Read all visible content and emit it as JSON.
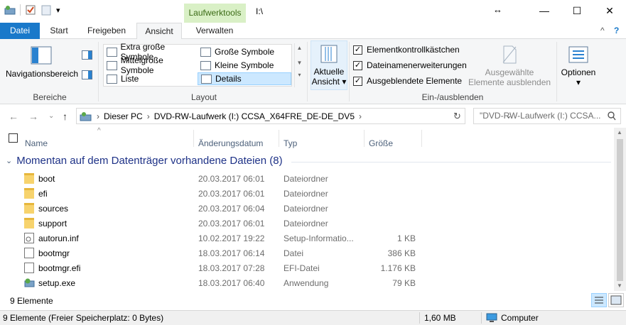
{
  "window": {
    "title": "I:\\",
    "context_tab_group": "Laufwerktools",
    "controls": {
      "minimize": "—",
      "maximize": "☐",
      "close": "✕",
      "resize": "↔"
    }
  },
  "qat": {
    "dropdown": "▾"
  },
  "tabs": {
    "file": "Datei",
    "start": "Start",
    "share": "Freigeben",
    "view": "Ansicht",
    "manage": "Verwalten"
  },
  "ribbon_controls": {
    "collapse": "^",
    "help": "?"
  },
  "ribbon": {
    "panes": {
      "label": "Bereiche",
      "nav_pane": "Navigationsbereich"
    },
    "layout": {
      "label": "Layout",
      "items": {
        "extra_large": "Extra große Symbole",
        "large": "Große Symbole",
        "medium": "Mittelgroße Symbole",
        "small": "Kleine Symbole",
        "list": "Liste",
        "details": "Details"
      }
    },
    "current_view": {
      "line1": "Aktuelle",
      "line2": "Ansicht"
    },
    "show_hide": {
      "label": "Ein-/ausblenden",
      "checkboxes": "Elementkontrollkästchen",
      "extensions": "Dateinamenerweiterungen",
      "hidden": "Ausgeblendete Elemente",
      "hide_selected_1": "Ausgewählte",
      "hide_selected_2": "Elemente ausblenden"
    },
    "options": "Optionen"
  },
  "address": {
    "crumbs": [
      "Dieser PC",
      "DVD-RW-Laufwerk (I:) CCSA_X64FRE_DE-DE_DV5"
    ],
    "separator": "›",
    "search_placeholder": "\"DVD-RW-Laufwerk (I:) CCSA..."
  },
  "columns": {
    "name": "Name",
    "date": "Änderungsdatum",
    "type": "Typ",
    "size": "Größe"
  },
  "group": {
    "title": "Momentan auf dem Datenträger vorhandene Dateien (8)"
  },
  "files": [
    {
      "name": "boot",
      "date": "20.03.2017 06:01",
      "type": "Dateiordner",
      "size": "",
      "icon": "folder-icon"
    },
    {
      "name": "efi",
      "date": "20.03.2017 06:01",
      "type": "Dateiordner",
      "size": "",
      "icon": "folder-icon"
    },
    {
      "name": "sources",
      "date": "20.03.2017 06:04",
      "type": "Dateiordner",
      "size": "",
      "icon": "folder-icon"
    },
    {
      "name": "support",
      "date": "20.03.2017 06:01",
      "type": "Dateiordner",
      "size": "",
      "icon": "folder-icon"
    },
    {
      "name": "autorun.inf",
      "date": "10.02.2017 19:22",
      "type": "Setup-Informatio...",
      "size": "1 KB",
      "icon": "settings-file-icon"
    },
    {
      "name": "bootmgr",
      "date": "18.03.2017 06:14",
      "type": "Datei",
      "size": "386 KB",
      "icon": "file-icon"
    },
    {
      "name": "bootmgr.efi",
      "date": "18.03.2017 07:28",
      "type": "EFI-Datei",
      "size": "1.176 KB",
      "icon": "file-icon"
    },
    {
      "name": "setup.exe",
      "date": "18.03.2017 06:40",
      "type": "Anwendung",
      "size": "79 KB",
      "icon": "setup-app-icon"
    }
  ],
  "item_count": "9 Elemente",
  "status": {
    "left": "9 Elemente (Freier Speicherplatz: 0 Bytes)",
    "size": "1,60 MB",
    "location": "Computer"
  },
  "colors": {
    "file_tab": "#1979ca",
    "context_tab": "#d9f0c6",
    "group_header": "#1e3287",
    "selection": "#cce8ff"
  }
}
